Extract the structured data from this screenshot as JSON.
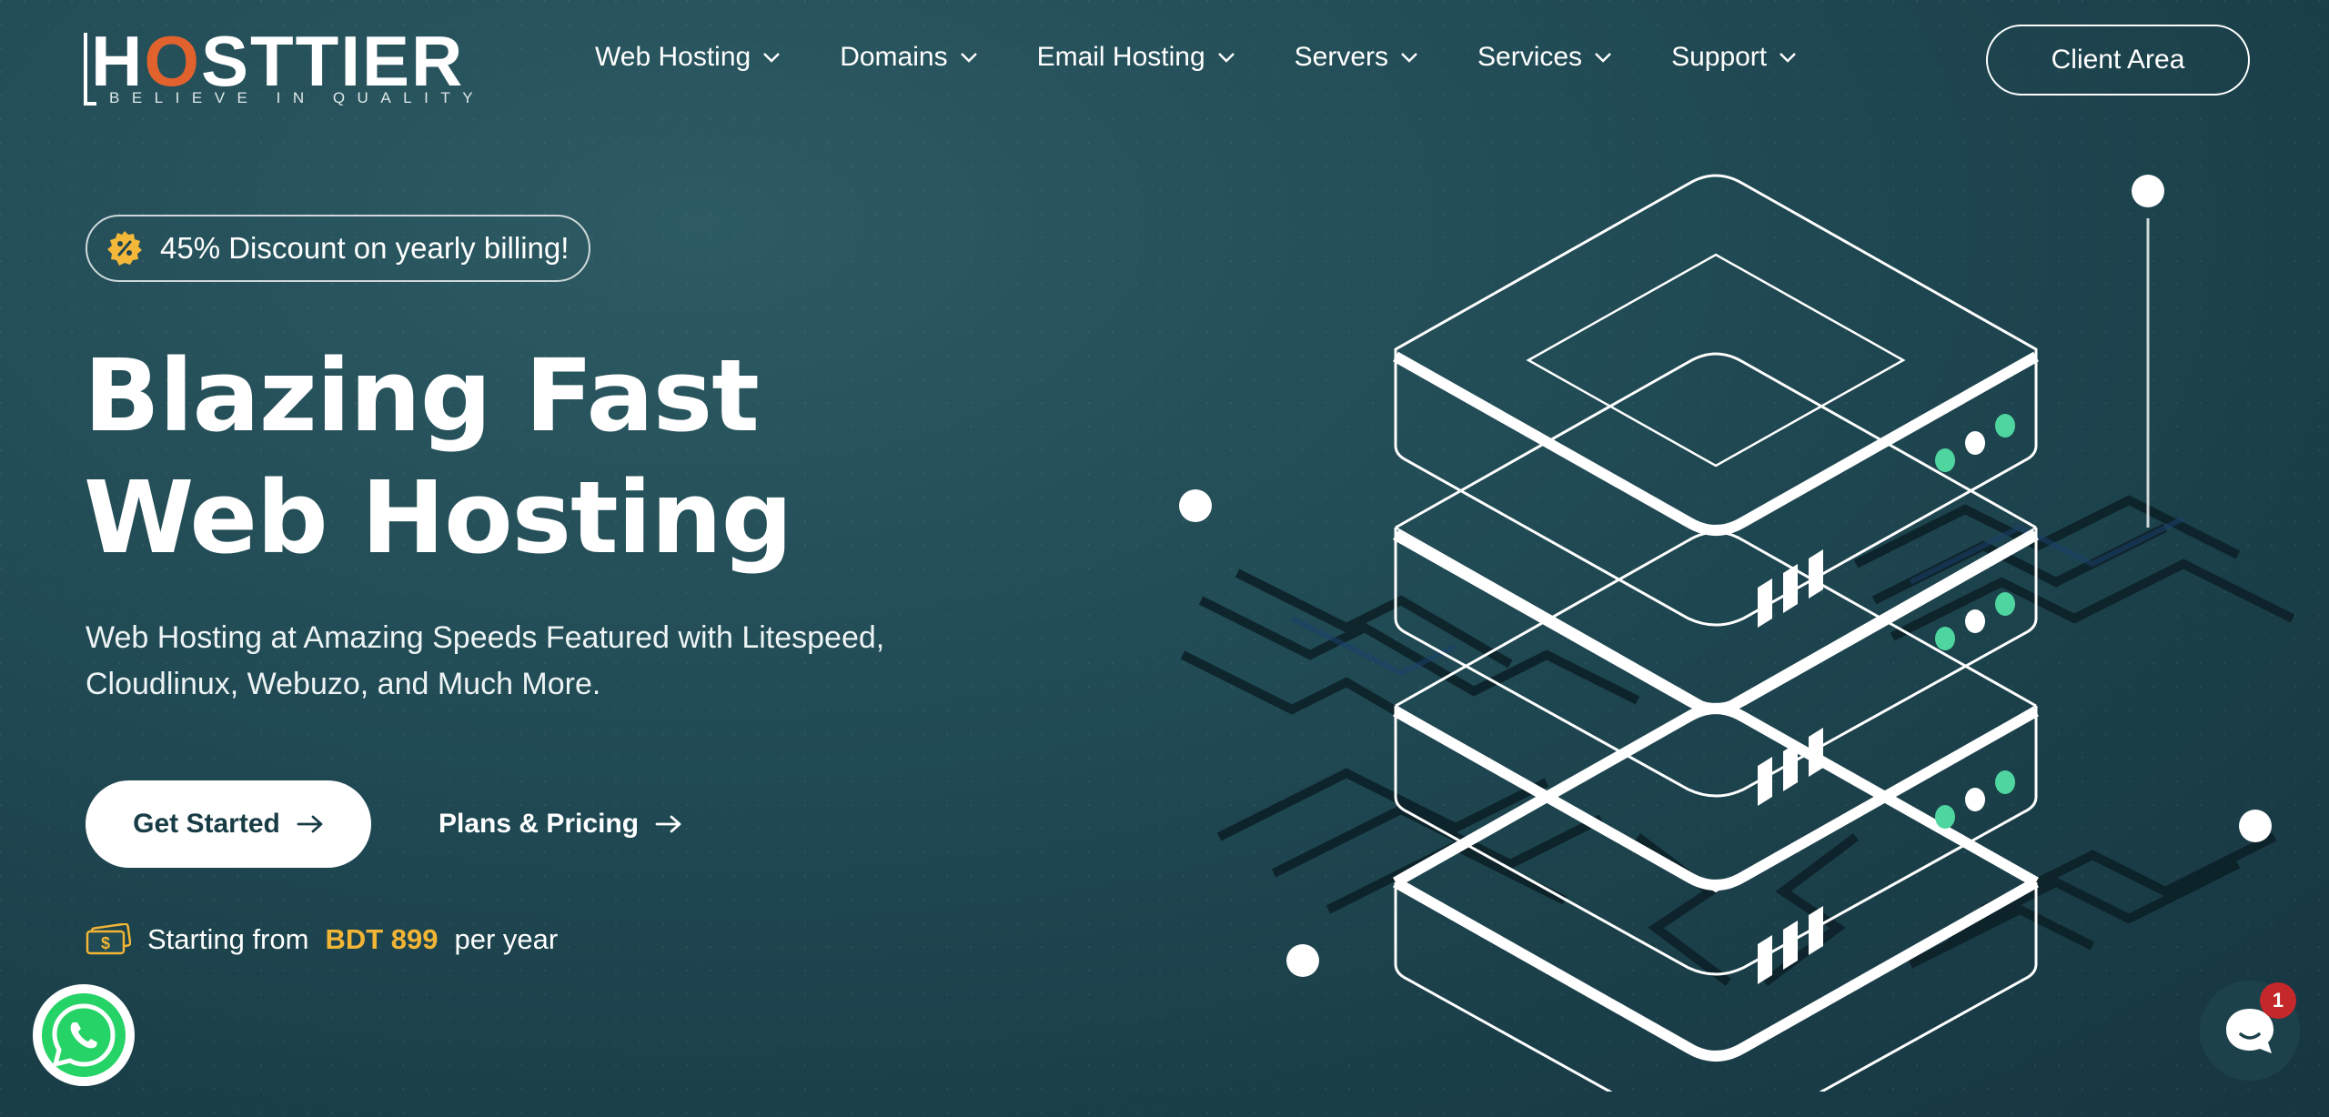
{
  "brand": {
    "logo_pre": "H",
    "logo_o": "O",
    "logo_post": "STTIER",
    "tagline": "BELIEVE IN QUALITY",
    "accent_color": "#e2622e"
  },
  "nav": {
    "items": [
      {
        "label": "Web Hosting"
      },
      {
        "label": "Domains"
      },
      {
        "label": "Email Hosting"
      },
      {
        "label": "Servers"
      },
      {
        "label": "Services"
      },
      {
        "label": "Support"
      }
    ],
    "client_area_label": "Client Area"
  },
  "hero": {
    "badge_text": "45% Discount on yearly billing!",
    "badge_color": "#f3b83a",
    "title_line1": "Blazing Fast",
    "title_line2": "Web Hosting",
    "subtitle_line1": "Web Hosting at Amazing Speeds Featured with Litespeed,",
    "subtitle_line2": "Cloudlinux, Webuzo, and Much More.",
    "primary_button_label": "Get Started",
    "secondary_link_label": "Plans & Pricing",
    "price_prefix": "Starting from",
    "price_amount": "BDT 899",
    "price_suffix": "per year",
    "price_color": "#f2b535"
  },
  "floating": {
    "chat_unread_count": "1",
    "whatsapp_icon": "whatsapp-icon",
    "chat_icon": "chat-icon"
  },
  "illustration": {
    "server_led_color": "#4fd6a0",
    "server_count": 4
  }
}
